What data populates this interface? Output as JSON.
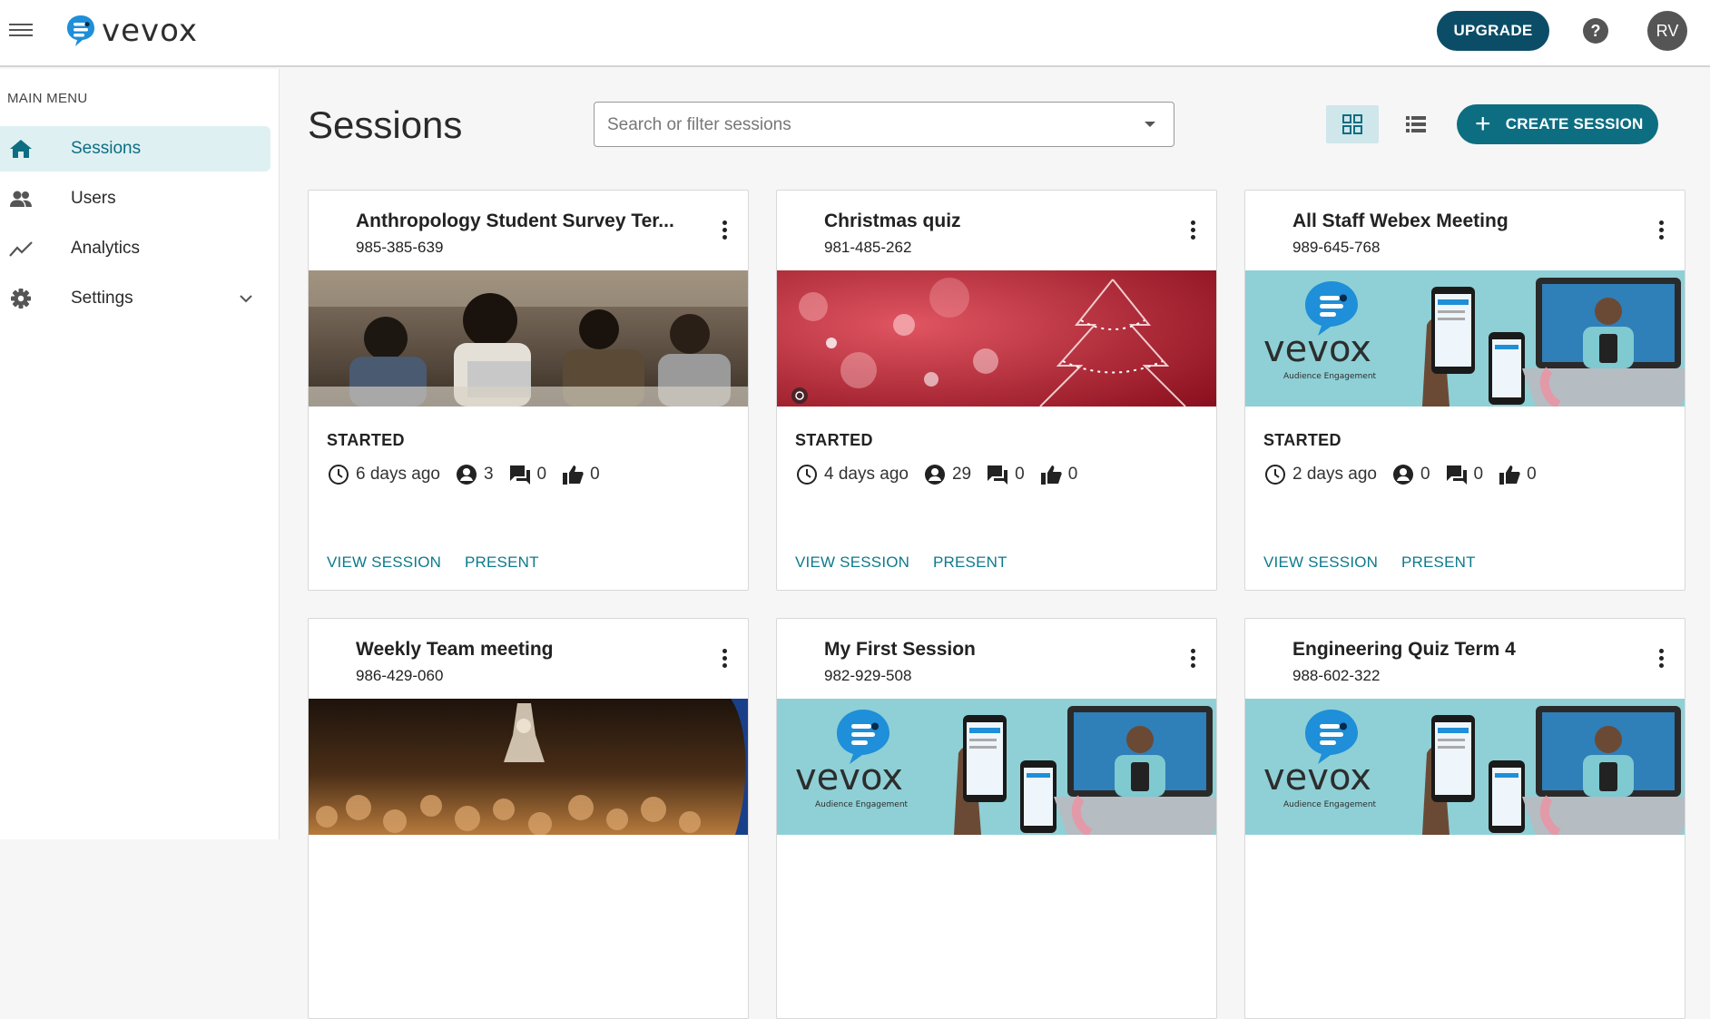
{
  "app": {
    "logo_text": "vevox"
  },
  "header": {
    "upgrade_label": "UPGRADE",
    "help_label": "?",
    "avatar_initials": "RV"
  },
  "sidebar": {
    "heading": "MAIN MENU",
    "items": [
      {
        "label": "Sessions",
        "icon": "home-icon",
        "active": true
      },
      {
        "label": "Users",
        "icon": "users-icon"
      },
      {
        "label": "Analytics",
        "icon": "analytics-icon"
      },
      {
        "label": "Settings",
        "icon": "gear-icon"
      }
    ]
  },
  "main": {
    "title": "Sessions",
    "search": {
      "placeholder": "Search or filter sessions",
      "value": ""
    },
    "create_label": "CREATE SESSION",
    "view_mode": "grid"
  },
  "cards": [
    {
      "title": "Anthropology Student Survey Ter...",
      "code": "985-385-639",
      "image": "students-photo",
      "status": "STARTED",
      "time": "6 days ago",
      "participants": "3",
      "comments": "0",
      "likes": "0",
      "view_label": "VIEW SESSION",
      "present_label": "PRESENT"
    },
    {
      "title": "Christmas quiz",
      "code": "981-485-262",
      "image": "christmas-bokeh",
      "status": "STARTED",
      "time": "4 days ago",
      "participants": "29",
      "comments": "0",
      "likes": "0",
      "view_label": "VIEW SESSION",
      "present_label": "PRESENT"
    },
    {
      "title": "All Staff Webex Meeting",
      "code": "989-645-768",
      "image": "vevox-promo",
      "status": "STARTED",
      "time": "2 days ago",
      "participants": "0",
      "comments": "0",
      "likes": "0",
      "view_label": "VIEW SESSION",
      "present_label": "PRESENT"
    },
    {
      "title": "Weekly Team meeting",
      "code": "986-429-060",
      "image": "crowd-photo"
    },
    {
      "title": "My First Session",
      "code": "982-929-508",
      "image": "vevox-promo"
    },
    {
      "title": "Engineering Quiz Term 4",
      "code": "988-602-322",
      "image": "vevox-promo"
    }
  ],
  "promo": {
    "logo_text": "vevox",
    "tagline": "Audience Engagement"
  },
  "colors": {
    "brand_dark": "#0b4d66",
    "brand_teal": "#0d6e82",
    "link": "#0d7a8c",
    "active_bg": "#dff0f2"
  }
}
